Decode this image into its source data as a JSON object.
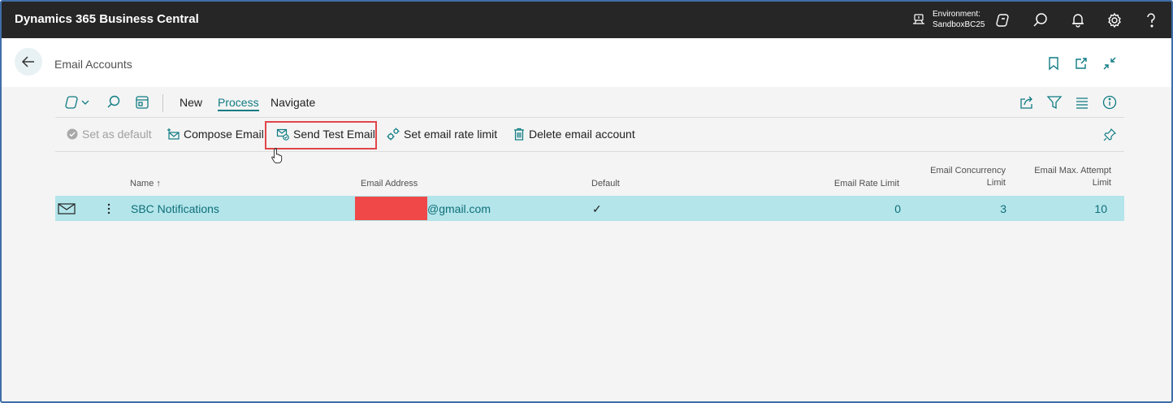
{
  "app": {
    "title": "Dynamics 365 Business Central"
  },
  "environment": {
    "label": "Environment:",
    "name": "SandboxBC25"
  },
  "header": {
    "title": "Email Accounts"
  },
  "actionbar": {
    "menus": [
      "New",
      "Process",
      "Navigate"
    ],
    "active_menu": "Process"
  },
  "actions": {
    "set_default": "Set as default",
    "compose": "Compose Email",
    "send_test": "Send Test Email",
    "rate_limit": "Set email rate limit",
    "delete": "Delete email account"
  },
  "table": {
    "columns": {
      "name": "Name",
      "name_sort": "↑",
      "email": "Email Address",
      "default": "Default",
      "rate": "Email Rate Limit",
      "concurrency_1": "Email Concurrency",
      "concurrency_2": "Limit",
      "max_attempt_1": "Email Max. Attempt",
      "max_attempt_2": "Limit"
    },
    "rows": [
      {
        "name": "SBC Notifications",
        "email_domain": "@gmail.com",
        "default": "✓",
        "rate_limit": "0",
        "concurrency": "3",
        "max_attempt": "10"
      }
    ]
  },
  "colors": {
    "accent": "#0f7b83",
    "topbar": "#262626",
    "row_selected": "#b3e5ea",
    "highlight": "#e0464a",
    "redaction": "#f04848"
  }
}
